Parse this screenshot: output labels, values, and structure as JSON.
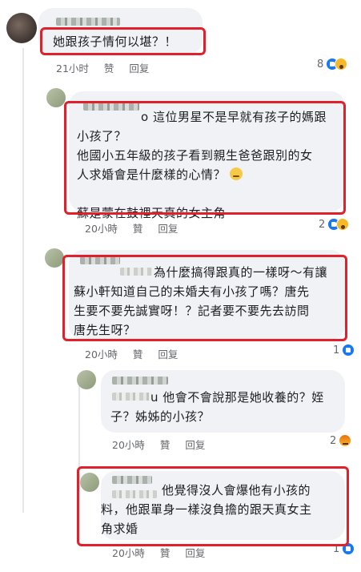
{
  "comments": [
    {
      "text_lines": [
        "她跟孩子情何以堪？！"
      ],
      "time": "21小时",
      "like_label": "赞",
      "reply_label": "回复",
      "reaction_count": "8"
    },
    {
      "text_lines": [
        "o 這位男星不是早就有孩子的媽跟",
        "小孩了？",
        "他國小五年級的孩子看到親生爸爸跟別的女",
        "人求婚會是什麼樣的心情？",
        "",
        "蘇是蒙在鼓裡天真的女主角"
      ],
      "time": "20小時",
      "like_label": "贊",
      "reply_label": "回复",
      "reaction_count": "2"
    },
    {
      "text_lines": [
        "為什麼搞得跟真的一樣呀～有讓",
        "蘇小軒知道自己的未婚夫有小孩了嗎？唐先",
        "生要不要先誠實呀！？記者要不要先去訪問",
        "唐先生呀？"
      ],
      "time": "20小時",
      "like_label": "贊",
      "reply_label": "回复",
      "reaction_count": "1"
    },
    {
      "text_lines": [
        "u 他會不會說那是她收養的？姪",
        "子？姊姊的小孩？"
      ],
      "time": "20小時",
      "like_label": "贊",
      "reply_label": "回复",
      "reaction_count": "2"
    },
    {
      "text_lines": [
        "他覺得沒人會爆他有小孩的",
        "料，他跟單身一樣沒負擔的跟天真女主",
        "角求婚"
      ],
      "time": "20小時",
      "like_label": "贊",
      "reply_label": "回复",
      "reaction_count": "1"
    }
  ],
  "colors": {
    "highlight": "#e0202a",
    "bubble": "#f0f2f5",
    "meta_text": "#65676b",
    "like_blue": "#1877f2"
  }
}
